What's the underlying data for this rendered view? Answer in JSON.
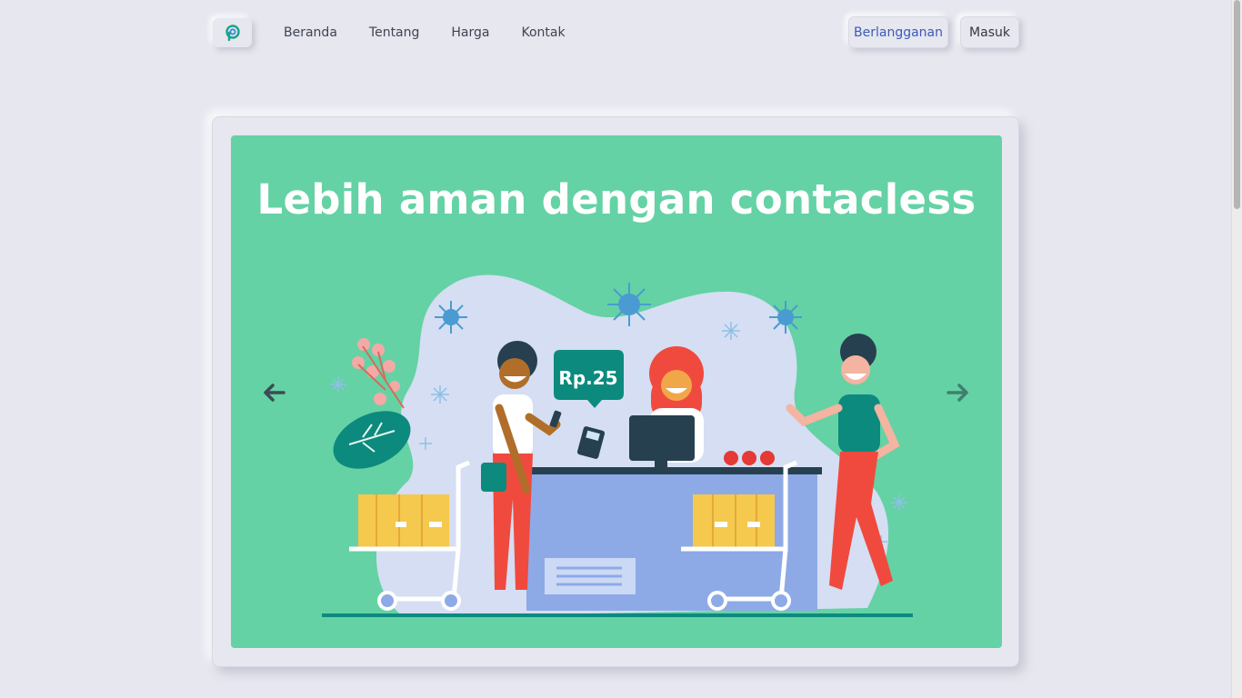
{
  "header": {
    "logo_icon": "p-logo-icon",
    "nav": [
      "Beranda",
      "Tentang",
      "Harga",
      "Kontak"
    ],
    "subscribe_label": "Berlangganan",
    "login_label": "Masuk"
  },
  "carousel": {
    "title": "Lebih aman dengan contacless",
    "price_bubble": "Rp.25",
    "prev_icon": "arrow-left-icon",
    "next_icon": "arrow-right-icon"
  },
  "colors": {
    "background": "#e6e7ef",
    "slide": "#64d2a4",
    "accent": "#3c5bb8",
    "teal": "#0d8a7e"
  }
}
